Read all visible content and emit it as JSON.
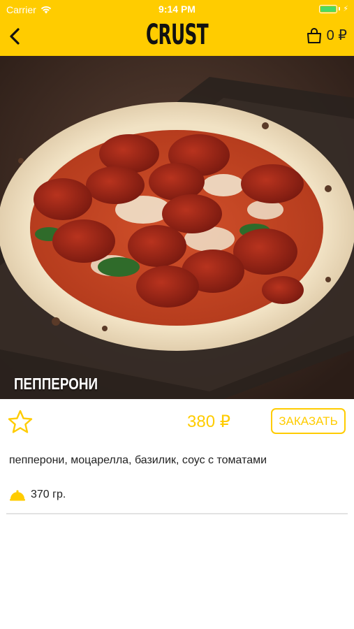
{
  "status_bar": {
    "carrier": "Carrier",
    "time": "9:14 PM",
    "battery_level": 1.0
  },
  "nav": {
    "logo": "CRUST",
    "cart": "0 ₽"
  },
  "product": {
    "title": "ПЕППЕРОНИ",
    "price": "380 ₽",
    "order_label": "ЗАКАЗАТЬ",
    "ingredients": "пепперони, моцарелла, базилик, соус с томатами",
    "weight": "370 гр."
  },
  "colors": {
    "accent": "#FFCC00",
    "divider": "#E2E2E2"
  },
  "icons": [
    "wifi-icon",
    "battery-icon",
    "back-chevron-icon",
    "cart-bag-icon",
    "star-outline-icon",
    "weight-dome-icon"
  ]
}
